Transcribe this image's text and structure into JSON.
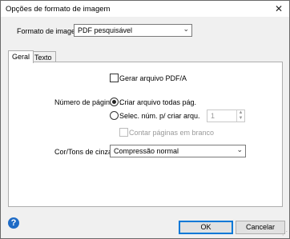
{
  "window": {
    "title": "Opções de formato de imagem"
  },
  "format": {
    "label": "Formato de imagem :",
    "value": "PDF pesquisável"
  },
  "tabs": [
    "Geral",
    "Texto"
  ],
  "general": {
    "pdfa_checkbox": "Gerar arquivo PDF/A",
    "pages_label": "Número de páginas :",
    "radio_all": "Criar arquivo todas pág.",
    "radio_select": "Selec. núm. p/ criar arqu.",
    "spin_value": "1",
    "count_blank": "Contar páginas em branco",
    "color_label": "Cor/Tons de cinza :",
    "color_value": "Compressão normal"
  },
  "buttons": {
    "ok": "OK",
    "cancel": "Cancelar"
  },
  "icons": {
    "help": "?"
  }
}
